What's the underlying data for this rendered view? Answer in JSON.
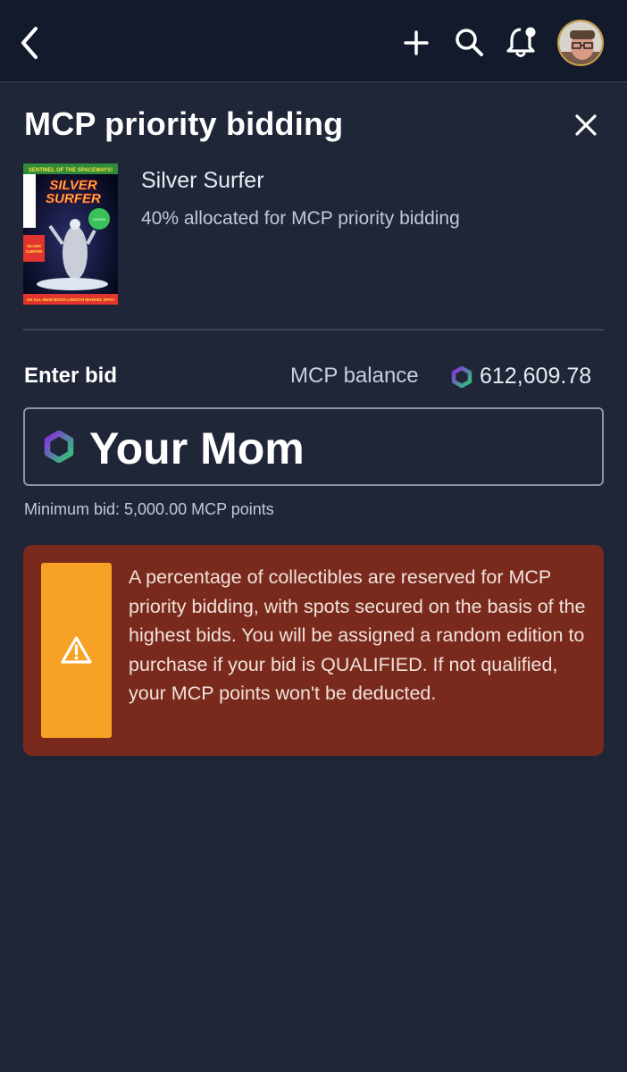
{
  "header": {
    "back_icon": "chevron-left-icon",
    "actions": [
      "plus-icon",
      "search-icon",
      "bell-icon"
    ],
    "avatar": "user-avatar"
  },
  "modal": {
    "title": "MCP priority bidding",
    "close_icon": "close-icon"
  },
  "item": {
    "name": "Silver Surfer",
    "allocation": "40% allocated for MCP priority bidding",
    "cover_title_lines": [
      "SILVER",
      "SURFER"
    ],
    "cover_tagline": "SENTINEL OF THE SPACEWAYS!",
    "cover_bottom": "AN ALL-NEW BOOK-LENGTH MARVEL EPIC!",
    "cover_badge": "THE ORIGIN OF THE SILVER SURFER!"
  },
  "bid": {
    "label": "Enter bid",
    "balance_label": "MCP balance",
    "balance_value": "612,609.78",
    "input_value": "Your Mom",
    "minimum": "Minimum bid: 5,000.00 MCP points"
  },
  "notice": {
    "icon": "warning-icon",
    "text": "A percentage of collectibles are reserved for MCP priority bidding, with spots secured on the basis of the highest bids. You will be assigned a random edition to purchase if your bid is QUALIFIED. If not qualified, your MCP points won't be deducted."
  },
  "colors": {
    "background": "#1f2638",
    "topbar": "#121a2c",
    "notice_bg": "#7a2a1c",
    "notice_badge": "#f7a225",
    "mcp_gradient": [
      "#8a2be2",
      "#2ecc71"
    ]
  }
}
